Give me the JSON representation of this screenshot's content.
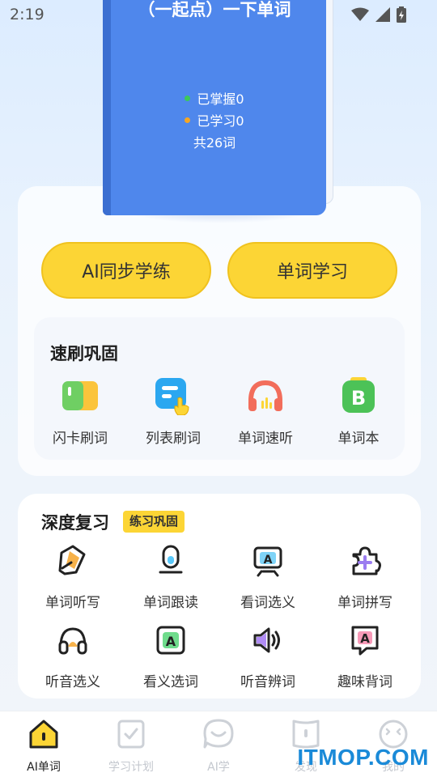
{
  "status_bar": {
    "time": "2:19"
  },
  "book": {
    "title": "（一起点）一下单词",
    "mastered": "已掌握0",
    "learned": "已学习0",
    "total": "共26词",
    "colors": {
      "cover": "#4f87ec",
      "mastered_dot": "#3cc85a",
      "learned_dot": "#f5a623"
    }
  },
  "actions": {
    "ai_sync": "AI同步学练",
    "word_study": "单词学习"
  },
  "quick_review": {
    "title": "速刷巩固",
    "items": [
      {
        "label": "闪卡刷词",
        "icon": "flashcard-icon"
      },
      {
        "label": "列表刷词",
        "icon": "list-tap-icon"
      },
      {
        "label": "单词速听",
        "icon": "headphones-icon"
      },
      {
        "label": "单词本",
        "icon": "word-book-icon"
      }
    ]
  },
  "deep_review": {
    "title": "深度复习",
    "tag": "练习巩固",
    "items": [
      {
        "label": "单词听写",
        "icon": "pencil-icon"
      },
      {
        "label": "单词跟读",
        "icon": "microphone-icon"
      },
      {
        "label": "看词选义",
        "icon": "letter-board-icon"
      },
      {
        "label": "单词拼写",
        "icon": "puzzle-icon"
      },
      {
        "label": "听音选义",
        "icon": "headset-icon"
      },
      {
        "label": "看义选词",
        "icon": "letter-frame-icon"
      },
      {
        "label": "听音辨词",
        "icon": "speaker-icon"
      },
      {
        "label": "趣味背词",
        "icon": "letter-bubble-icon"
      }
    ]
  },
  "bottom_nav": {
    "items": [
      {
        "label": "AI单词",
        "active": true
      },
      {
        "label": "学习计划",
        "active": false
      },
      {
        "label": "AI学",
        "active": false
      },
      {
        "label": "发现",
        "active": false
      },
      {
        "label": "我的",
        "active": false
      }
    ]
  },
  "watermark": "ITMOP.COM",
  "colors": {
    "accent_yellow": "#fcd535",
    "brand_blue": "#4f87ec",
    "watermark_blue": "#1a8ad8"
  }
}
